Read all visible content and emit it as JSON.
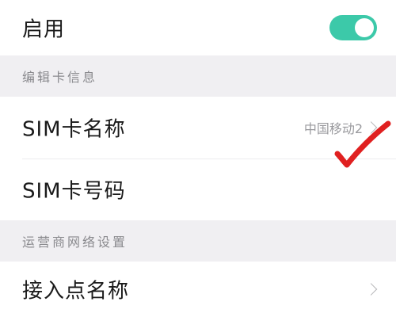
{
  "enable_row": {
    "label": "启用",
    "toggle_on": true
  },
  "section_card_info": {
    "title": "编辑卡信息"
  },
  "sim_name_row": {
    "label": "SIM卡名称",
    "value": "中国移动2"
  },
  "sim_number_row": {
    "label": "SIM卡号码"
  },
  "section_carrier": {
    "title": "运营商网络设置"
  },
  "apn_row": {
    "label": "接入点名称"
  },
  "colors": {
    "toggle_accent": "#3cc9a9",
    "annotation_red": "#e02020"
  }
}
